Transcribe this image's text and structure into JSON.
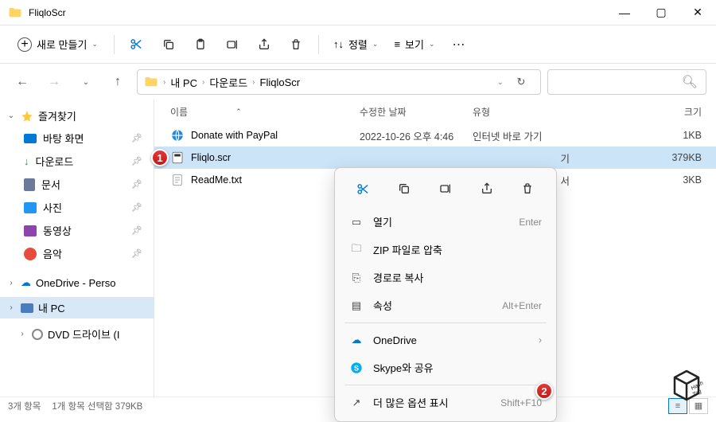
{
  "window": {
    "title": "FliqloScr"
  },
  "toolbar": {
    "new_label": "새로 만들기",
    "sort_label": "정렬",
    "view_label": "보기"
  },
  "breadcrumb": [
    "내 PC",
    "다운로드",
    "FliqloScr"
  ],
  "sidebar": {
    "favorites": "즐겨찾기",
    "items": [
      {
        "label": "바탕 화면"
      },
      {
        "label": "다운로드"
      },
      {
        "label": "문서"
      },
      {
        "label": "사진"
      },
      {
        "label": "동영상"
      },
      {
        "label": "음악"
      }
    ],
    "onedrive": "OneDrive - Perso",
    "thispc": "내 PC",
    "dvd": "DVD 드라이브 (I"
  },
  "columns": {
    "name": "이름",
    "date": "수정한 날짜",
    "type": "유형",
    "size": "크기"
  },
  "files": [
    {
      "name": "Donate with PayPal",
      "date": "2022-10-26 오후 4:46",
      "type": "인터넷 바로 가기",
      "size": "1KB"
    },
    {
      "name": "Fliqlo.scr",
      "date": "",
      "type": "기",
      "size": "379KB"
    },
    {
      "name": "ReadMe.txt",
      "date": "",
      "type": "서",
      "size": "3KB"
    }
  ],
  "ctx": {
    "open": "열기",
    "open_sc": "Enter",
    "zip": "ZIP 파일로 압축",
    "copypath": "경로로 복사",
    "props": "속성",
    "props_sc": "Alt+Enter",
    "onedrive": "OneDrive",
    "skype": "Skype와 공유",
    "more": "더 많은 옵션 표시",
    "more_sc": "Shift+F10"
  },
  "status": {
    "count": "3개 항목",
    "selected": "1개 항목 선택함 379KB"
  }
}
